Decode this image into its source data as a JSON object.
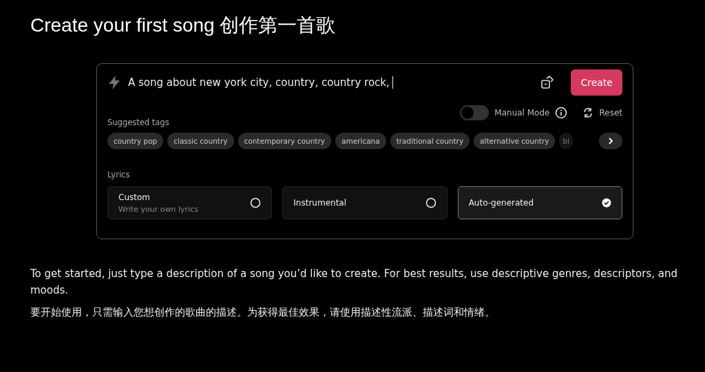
{
  "heading": "Create your first song 创作第一首歌",
  "prompt": {
    "value": "A song about new york city, country, country rock,"
  },
  "create_button": "Create",
  "manual_mode": {
    "label": "Manual Mode",
    "on": false
  },
  "reset_button": "Reset",
  "tags_label": "Suggested tags",
  "tags": [
    "country pop",
    "classic country",
    "contemporary country",
    "americana",
    "traditional country",
    "alternative country",
    "bl"
  ],
  "lyrics_label": "Lyrics",
  "lyrics_options": [
    {
      "title": "Custom",
      "subtitle": "Write your own lyrics",
      "selected": false
    },
    {
      "title": "Instrumental",
      "selected": false
    },
    {
      "title": "Auto-generated",
      "selected": true
    }
  ],
  "paragraphs": [
    "To get started, just type a description of a song you’d like to create. For best results, use descriptive genres, descriptors, and moods.",
    "要开始使用，只需输入您想创作的歌曲的描述。为获得最佳效果，请使用描述性流派、描述词和情绪。"
  ]
}
